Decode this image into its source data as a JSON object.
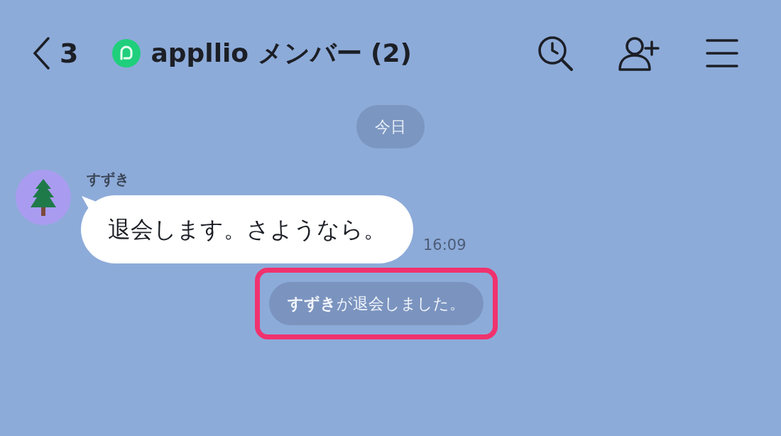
{
  "header": {
    "back_count": "3",
    "title": "appllio メンバー (2)"
  },
  "date_divider": "今日",
  "messages": [
    {
      "kind": "text",
      "sender": "すずき",
      "text": "退会します。さようなら。",
      "time": "16:09"
    },
    {
      "kind": "system",
      "text": "**すずき**が退会しました。",
      "highlighted": true
    }
  ]
}
